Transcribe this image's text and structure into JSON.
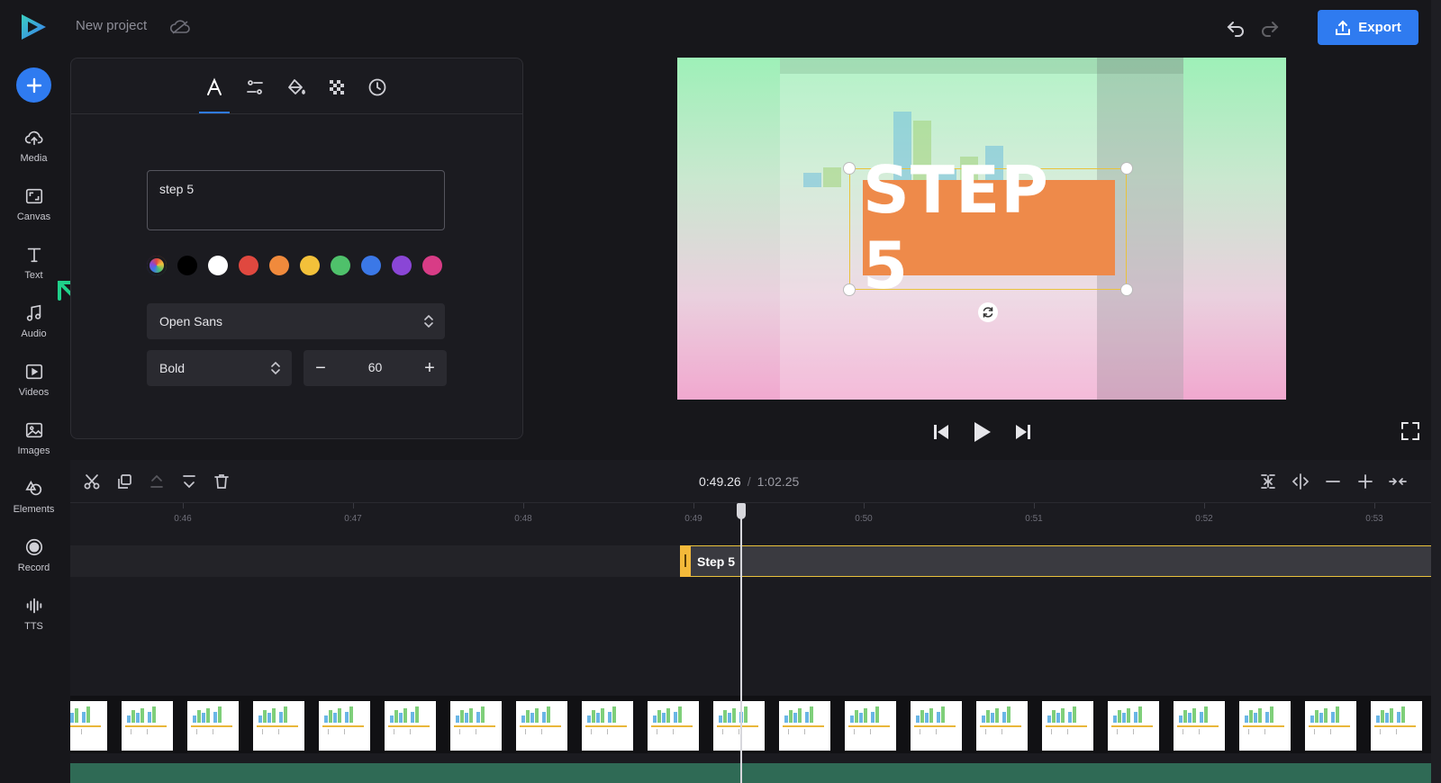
{
  "app": {
    "project_title": "New project",
    "export_label": "Export"
  },
  "sidebar": {
    "items": [
      {
        "label": "Media",
        "icon": "upload-cloud-icon"
      },
      {
        "label": "Canvas",
        "icon": "canvas-icon"
      },
      {
        "label": "Text",
        "icon": "text-icon"
      },
      {
        "label": "Audio",
        "icon": "music-note-icon"
      },
      {
        "label": "Videos",
        "icon": "video-play-icon"
      },
      {
        "label": "Images",
        "icon": "image-icon"
      },
      {
        "label": "Elements",
        "icon": "shapes-icon"
      },
      {
        "label": "Record",
        "icon": "record-icon"
      },
      {
        "label": "TTS",
        "icon": "waveform-icon"
      }
    ]
  },
  "text_panel": {
    "tabs": [
      "text-format-icon",
      "adjustments-icon",
      "fill-icon",
      "transparency-icon",
      "timing-icon"
    ],
    "active_tab": 0,
    "text_value": "step 5",
    "colors": [
      "#000000",
      "#ffffff",
      "#e0483f",
      "#f08a3c",
      "#f3c13a",
      "#4fc16b",
      "#3b78e7",
      "#8a46d6",
      "#d83c86"
    ],
    "font_family": "Open Sans",
    "font_weight": "Bold",
    "font_size": "60",
    "minus_symbol": "−",
    "plus_symbol": "+"
  },
  "preview": {
    "overlay_text": "STEP 5",
    "overlay_color": "#ee8a4a",
    "selection_color": "#e9c23c"
  },
  "timeline": {
    "current_time": "0:49.26",
    "separator": "/",
    "total_time": "1:02.25",
    "ruler_labels": [
      "0:46",
      "0:47",
      "0:48",
      "0:49",
      "0:50",
      "0:51",
      "0:52",
      "0:53"
    ],
    "clip_label": "Step 5"
  }
}
